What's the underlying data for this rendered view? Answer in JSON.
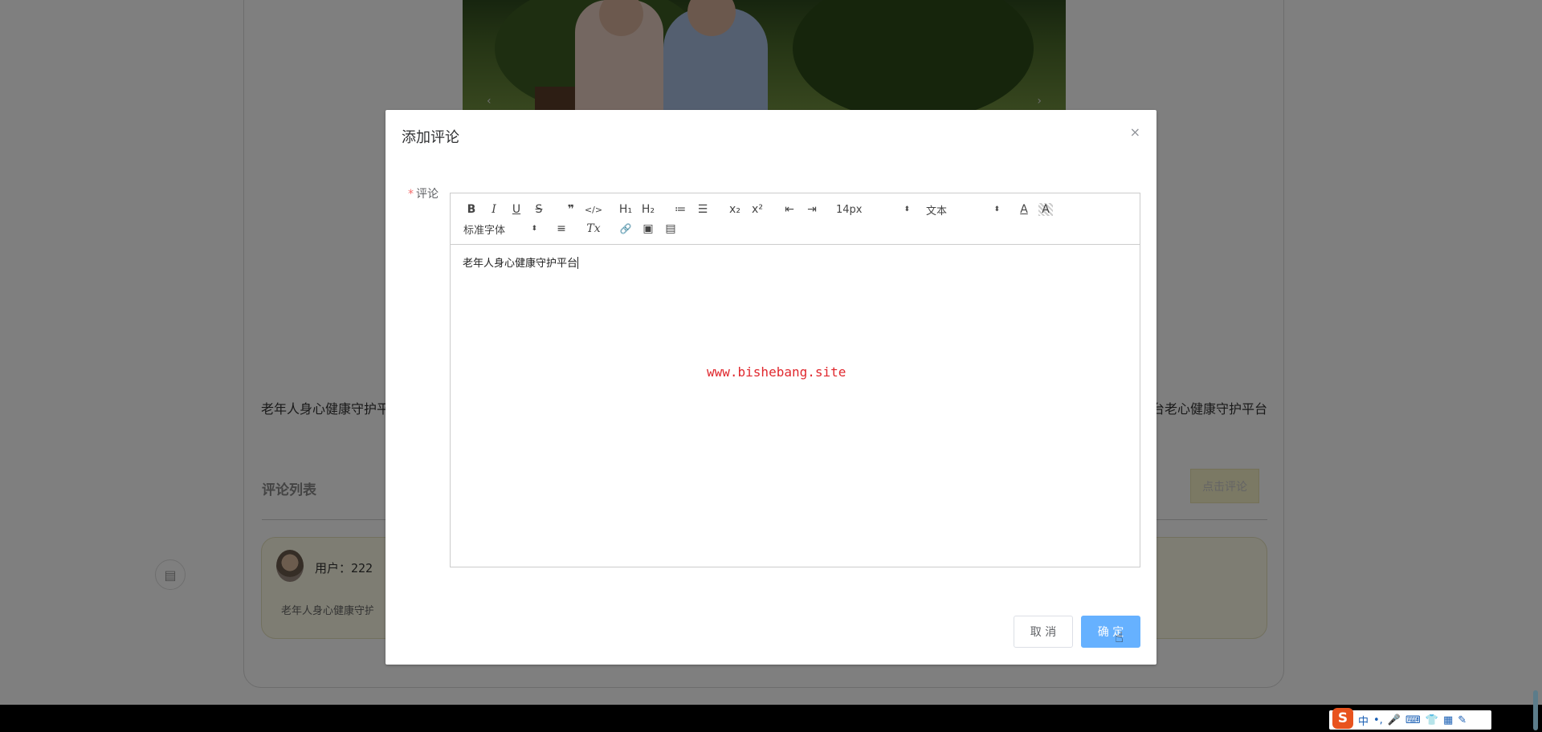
{
  "background": {
    "carousel": {
      "prev_label": "‹",
      "next_label": "›"
    },
    "description_left": "老年人身心健康守护平台老年人身心健康守护平台",
    "description_right": "心健康守护平台老心健康守护平台",
    "comment_list_title": "评论列表",
    "add_comment_button": "点击评论",
    "comment": {
      "user_label": "用户：222",
      "text": "老年人身心健康守护平台"
    }
  },
  "dialog": {
    "title": "添加评论",
    "close_icon": "×",
    "field_label": "评论",
    "required_mark": "*",
    "toolbar": {
      "row1": [
        {
          "name": "bold-icon",
          "glyph": "B"
        },
        {
          "name": "italic-icon",
          "glyph": "I"
        },
        {
          "name": "underline-icon",
          "glyph": "U"
        },
        {
          "name": "strikethrough-icon",
          "glyph": "S"
        },
        {
          "name": "quote-icon",
          "glyph": "❞"
        },
        {
          "name": "code-icon",
          "glyph": "</>"
        },
        {
          "name": "heading1-icon",
          "glyph": "H₁"
        },
        {
          "name": "heading2-icon",
          "glyph": "H₂"
        },
        {
          "name": "ordered-list-icon",
          "glyph": "≔"
        },
        {
          "name": "bullet-list-icon",
          "glyph": "☰"
        },
        {
          "name": "subscript-icon",
          "glyph": "x₂"
        },
        {
          "name": "superscript-icon",
          "glyph": "x²"
        },
        {
          "name": "outdent-icon",
          "glyph": "⇤"
        },
        {
          "name": "indent-icon",
          "glyph": "⇥"
        }
      ],
      "font_size": "14px",
      "header_select": "文本",
      "font_color_icon": "A",
      "background_color_icon": "A",
      "font_family": "标准字体",
      "align_icon": "≡",
      "clean_icon": "Tx",
      "link_icon": "🔗",
      "image_icon": "▣",
      "video_icon": "▤"
    },
    "editor_content": "老年人身心健康守护平台",
    "watermark": "www.bishebang.site",
    "cancel_label": "取 消",
    "confirm_label": "确 定"
  },
  "taskbar": {
    "ime_logo": "S",
    "ime_items": [
      "中",
      "•,",
      "🎤",
      "⌨",
      "👕",
      "▦",
      "✎"
    ]
  },
  "colors": {
    "overlay": "#00000080",
    "primary_button": "#66b1ff",
    "watermark": "#e0282e",
    "required": "#f56c6c"
  }
}
